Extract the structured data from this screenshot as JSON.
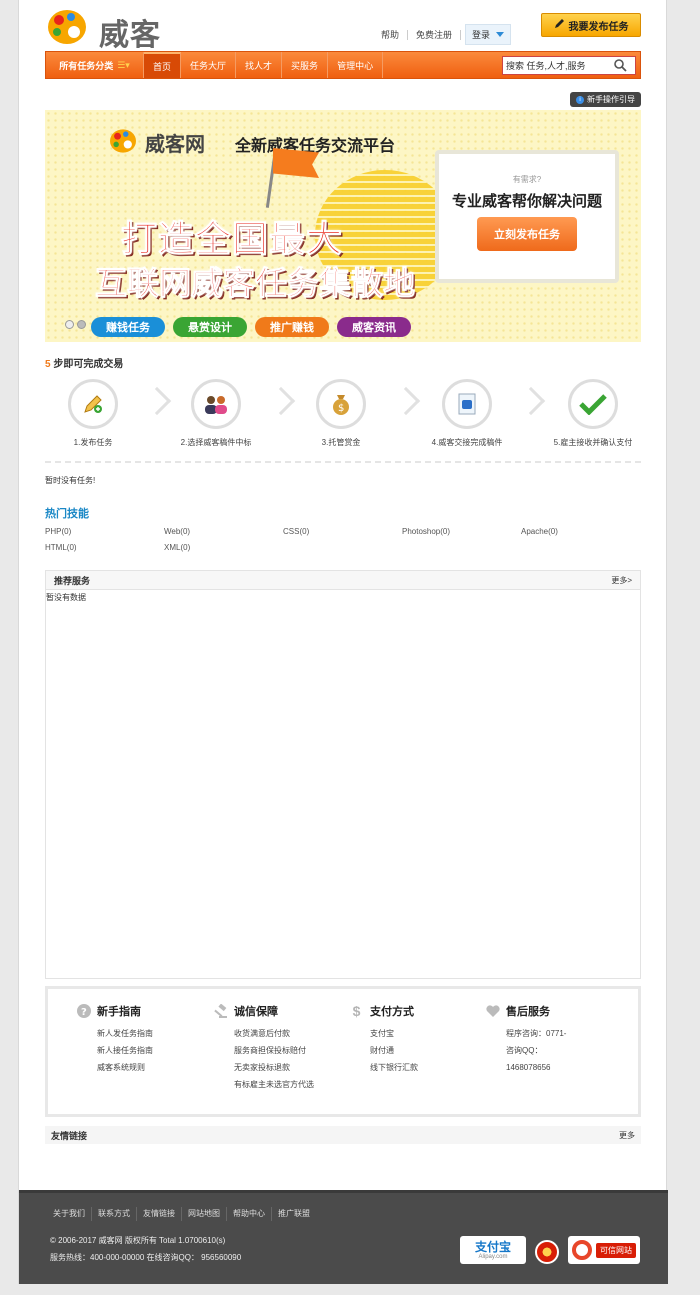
{
  "header": {
    "logo_text": "威客",
    "links": [
      "帮助",
      "免费注册"
    ],
    "login_label": "登录",
    "publish_label": "我要发布任务"
  },
  "nav": {
    "category_label": "所有任务分类",
    "items": [
      "首页",
      "任务大厅",
      "找人才",
      "买服务",
      "管理中心"
    ],
    "active_index": 0,
    "search_value": "搜索 任务,人才,服务"
  },
  "guide_label": "新手操作引导",
  "banner": {
    "logo_text": "威客网",
    "headline": "全新威客任务交流平台",
    "slogan_line1": "打造全国最大",
    "slogan_line2": "互联网威客任务集散地",
    "need_question": "有需求?",
    "need_title": "专业威客帮你解决问题",
    "need_button": "立刻发布任务",
    "tabs": [
      {
        "label": "赚钱任务",
        "color": "#1a8fd8"
      },
      {
        "label": "悬赏设计",
        "color": "#3aa534"
      },
      {
        "label": "推广赚钱",
        "color": "#f07a1a"
      },
      {
        "label": "威客资讯",
        "color": "#8a2b8c"
      }
    ]
  },
  "steps": {
    "title_num": "5",
    "title_text": " 步即可完成交易",
    "items": [
      {
        "label": "1.发布任务",
        "icon": "pencil-icon"
      },
      {
        "label": "2.选择威客稿件中标",
        "icon": "users-icon"
      },
      {
        "label": "3.托管赏金",
        "icon": "money-bag-icon"
      },
      {
        "label": "4.威客交接完成稿件",
        "icon": "document-icon"
      },
      {
        "label": "5.雇主接收并确认支付",
        "icon": "checkmark-icon"
      }
    ]
  },
  "no_task_text": "暂时没有任务!",
  "hot_skills": {
    "title": "热门技能",
    "items": [
      "PHP(0)",
      "Web(0)",
      "CSS(0)",
      "Photoshop(0)",
      "Apache(0)",
      "HTML(0)",
      "XML(0)"
    ]
  },
  "recommended": {
    "title": "推荐服务",
    "more": "更多>",
    "empty": "暂没有数据"
  },
  "service": {
    "columns": [
      {
        "title": "新手指南",
        "icon": "question-icon",
        "items": [
          "新人发任务指南",
          "新人接任务指南",
          "威客系统规则"
        ]
      },
      {
        "title": "诚信保障",
        "icon": "gavel-icon",
        "items": [
          "收货满意后付款",
          "服务商担保投标赔付",
          "无卖家投标退款",
          "有标雇主未选官方代选"
        ]
      },
      {
        "title": "支付方式",
        "icon": "dollar-icon",
        "items": [
          "支付宝",
          "财付通",
          "线下银行汇款"
        ]
      },
      {
        "title": "售后服务",
        "icon": "heart-icon",
        "items": [
          "程序咨询：0771-",
          "咨询QQ：",
          "1468078656"
        ]
      }
    ]
  },
  "friends": {
    "title": "友情链接",
    "more": "更多"
  },
  "footer": {
    "links": [
      "关于我们",
      "联系方式",
      "友情链接",
      "网站地图",
      "帮助中心",
      "推广联盟"
    ],
    "copyright": "© 2006-2017 威客网 版权所有 Total 1.0700610(s)",
    "hotline": "服务热线：400-000-00000 在线咨询QQ： 956560090",
    "alipay_main": "支付宝",
    "alipay_sub": "Alipay.com",
    "trust_label": "可信网站"
  },
  "colors": {
    "nav_orange": "#ef5f10",
    "accent_blue": "#1b88c6",
    "publish_yellow": "#f7a600"
  }
}
